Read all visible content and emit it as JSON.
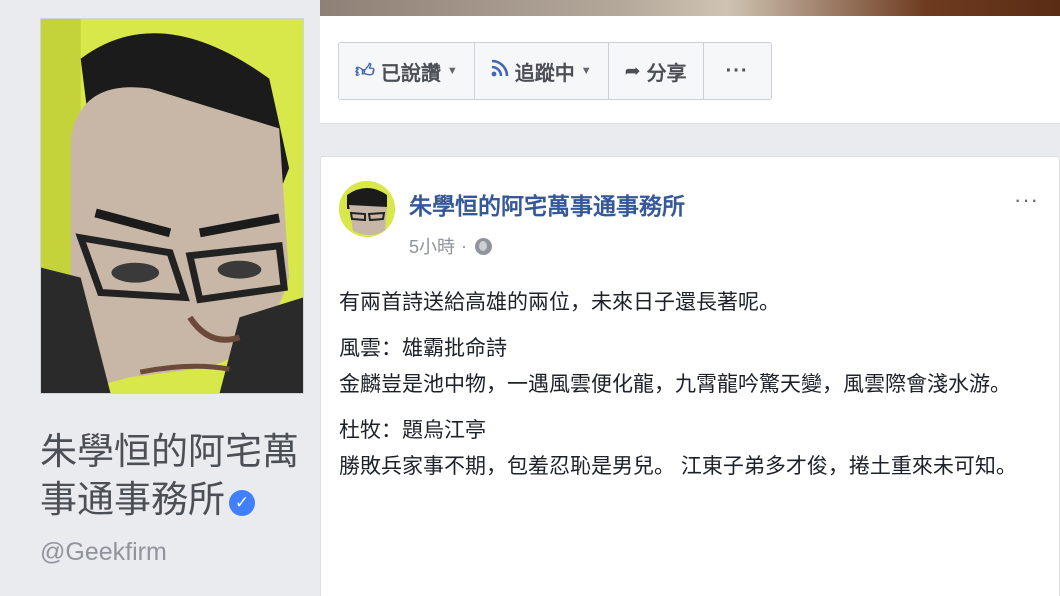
{
  "profile": {
    "name": "朱學恒的阿宅萬事通事務所",
    "handle": "@Geekfirm"
  },
  "actions": {
    "like_label": "已說讚",
    "follow_label": "追蹤中",
    "share_label": "分享",
    "more_label": "···"
  },
  "post": {
    "author": "朱學恒的阿宅萬事通事務所",
    "time": "5小時",
    "options_label": "···",
    "paragraphs": [
      "有兩首詩送給高雄的兩位，未來日子還長著呢。",
      "風雲：雄霸批命詩\n金麟豈是池中物，一遇風雲便化龍，九霄龍吟驚天變，風雲際會淺水游。",
      "杜牧：題烏江亭\n勝敗兵家事不期，包羞忍恥是男兒。 江東子弟多才俊，捲土重來未可知。"
    ]
  },
  "colors": {
    "link": "#365899",
    "verified": "#4080ff",
    "profile_bg": "#d8e84a"
  }
}
